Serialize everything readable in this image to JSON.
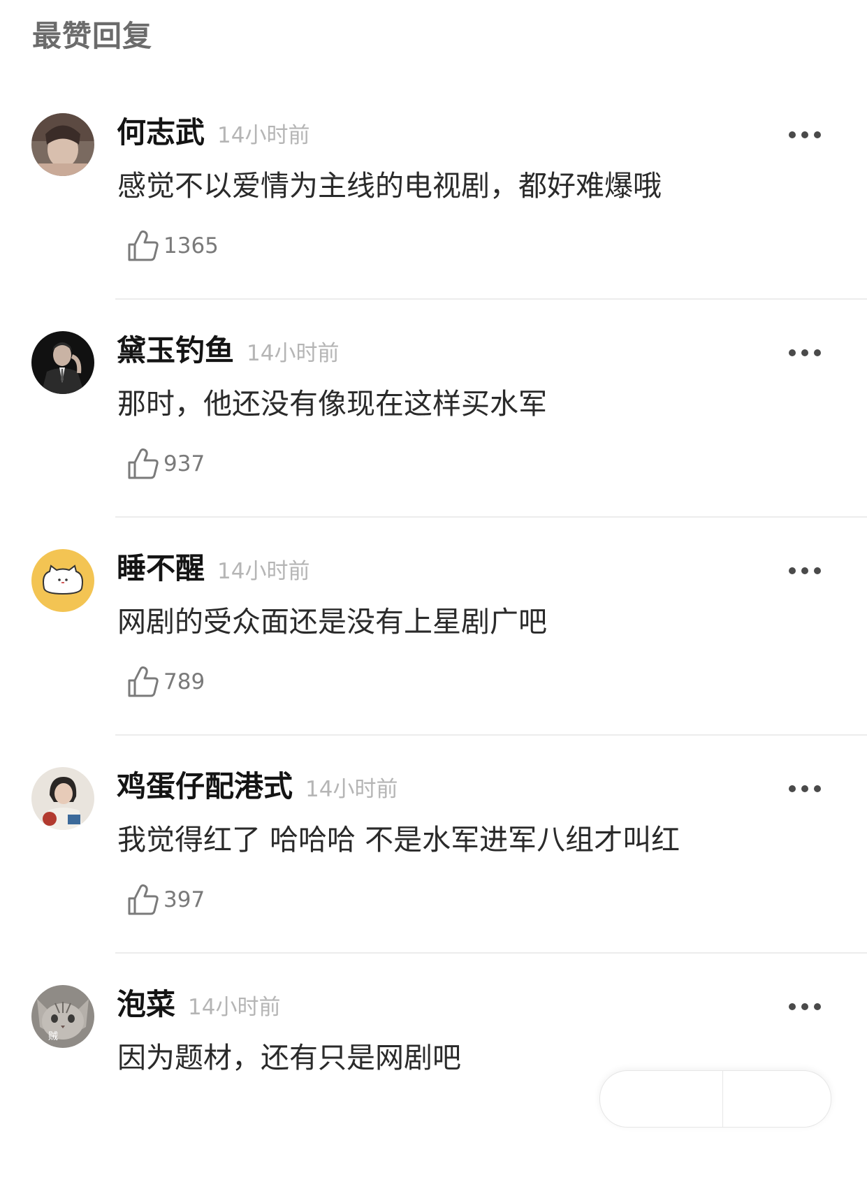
{
  "section_title": "最赞回复",
  "comments": [
    {
      "username": "何志武",
      "time": "14小时前",
      "text": "感觉不以爱情为主线的电视剧，都好难爆哦",
      "likes": "1365",
      "avatar_icon": "person-photo-avatar"
    },
    {
      "username": "黛玉钓鱼",
      "time": "14小时前",
      "text": "那时，他还没有像现在这样买水军",
      "likes": "937",
      "avatar_icon": "suit-portrait-avatar"
    },
    {
      "username": "睡不醒",
      "time": "14小时前",
      "text": "网剧的受众面还是没有上星剧广吧",
      "likes": "789",
      "avatar_icon": "cat-cartoon-avatar"
    },
    {
      "username": "鸡蛋仔配港式",
      "time": "14小时前",
      "text": "我觉得红了 哈哈哈 不是水军进军八组才叫红",
      "likes": "397",
      "avatar_icon": "person-photo-avatar"
    },
    {
      "username": "泡菜",
      "time": "14小时前",
      "text": "因为题材，还有只是网剧吧",
      "likes": "",
      "avatar_icon": "cat-photo-avatar",
      "avatar_text": "贼"
    }
  ],
  "icons": {
    "like": "thumbs-up-icon",
    "more": "more-dots-icon"
  },
  "colors": {
    "title": "#6b6b6b",
    "timestamp": "#b5b5b5",
    "divider": "#ececec",
    "avatar_yellow": "#f3c453"
  }
}
